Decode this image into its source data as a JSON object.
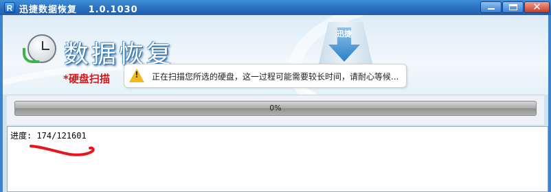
{
  "window": {
    "app_icon_letter": "R",
    "title": "迅捷数据恢复   1.0.1030",
    "close_glyph": "✕"
  },
  "header": {
    "big_title": "数据恢复",
    "arrow_text": "迅捷",
    "scan_label": "*硬盘扫描",
    "tooltip_icon": "warning-icon",
    "tooltip_mark": "!",
    "tooltip_text": "正在扫描您所选的硬盘，这一过程可能需要较长时间，请耐心等候..."
  },
  "progress": {
    "value": 0,
    "label": "0%"
  },
  "log": {
    "progress_line": "进度: 174/121601"
  },
  "colors": {
    "title_bar": "#2a6fc0",
    "scan_label": "#d21a1a",
    "annotation": "#e8141e"
  }
}
